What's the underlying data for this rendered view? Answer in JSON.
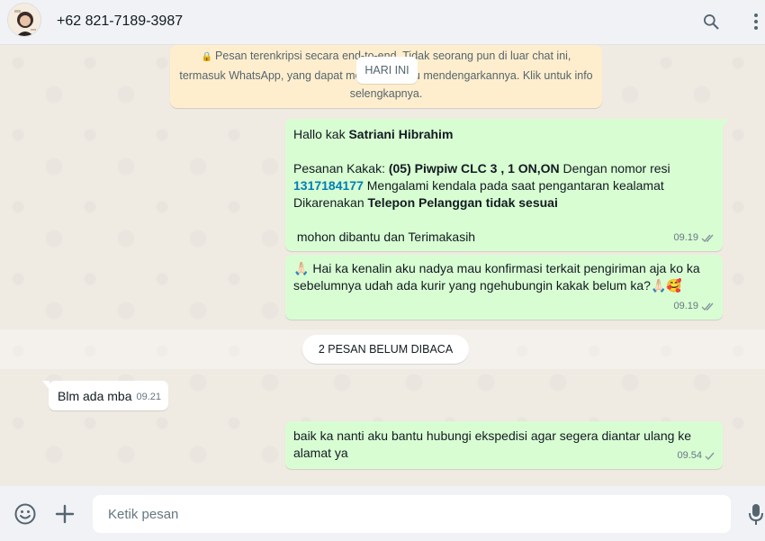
{
  "header": {
    "contact_name": "+62 821-7189-3987",
    "icons": [
      "search-icon",
      "menu-dots-icon"
    ]
  },
  "chat": {
    "encryption_notice": "Pesan terenkripsi secara end-to-end. Tidak seorang pun di luar chat ini, termasuk WhatsApp, yang dapat membaca atau mendengarkannya. Klik untuk info selengkapnya.",
    "date_chip": "HARI INI",
    "unread_chip": "2 PESAN BELUM DIBACA",
    "messages": [
      {
        "direction": "out",
        "line1_pre": "Hallo kak ",
        "line1_bold": "Satriani Hibrahim",
        "line2_pre": "Pesanan Kakak: ",
        "line2_bold": "(05) Piwpiw CLC 3 , 1 ON,ON",
        "line2_post": " Dengan nomor resi",
        "resi": "1317184177",
        "line3_post": " Mengalami kendala pada saat pengantaran kealamat",
        "line4_pre": "Dikarenakan ",
        "line4_bold": "Telepon Pelanggan tidak sesuai",
        "line5": " mohon dibantu dan Terimakasih",
        "time": "09.19",
        "status": "read"
      },
      {
        "direction": "out",
        "emoji_start": "🙏🏻",
        "text": "Hai ka kenalin aku nadya mau konfirmasi terkait pengiriman aja ko ka sebelumnya udah ada kurir yang ngehubungin kakak belum ka?",
        "emoji_end": "🙏🏻🥰",
        "time": "09.19",
        "status": "read"
      },
      {
        "direction": "in",
        "text": "Blm ada mba",
        "time": "09.21"
      },
      {
        "direction": "out",
        "text": "baik ka nanti aku bantu hubungi ekspedisi agar segera diantar ulang ke alamat ya",
        "time": "09.54",
        "status": "sent"
      }
    ]
  },
  "composer": {
    "placeholder": "Ketik pesan",
    "icons": [
      "emoji-icon",
      "plus-icon",
      "mic-icon"
    ]
  },
  "colors": {
    "outgoing_bubble": "#d9fdd3",
    "incoming_bubble": "#ffffff",
    "chat_background": "#efeae2",
    "notice_background": "#ffeecd",
    "resi_link": "#027eb5",
    "read_tick": "#8696a0"
  }
}
